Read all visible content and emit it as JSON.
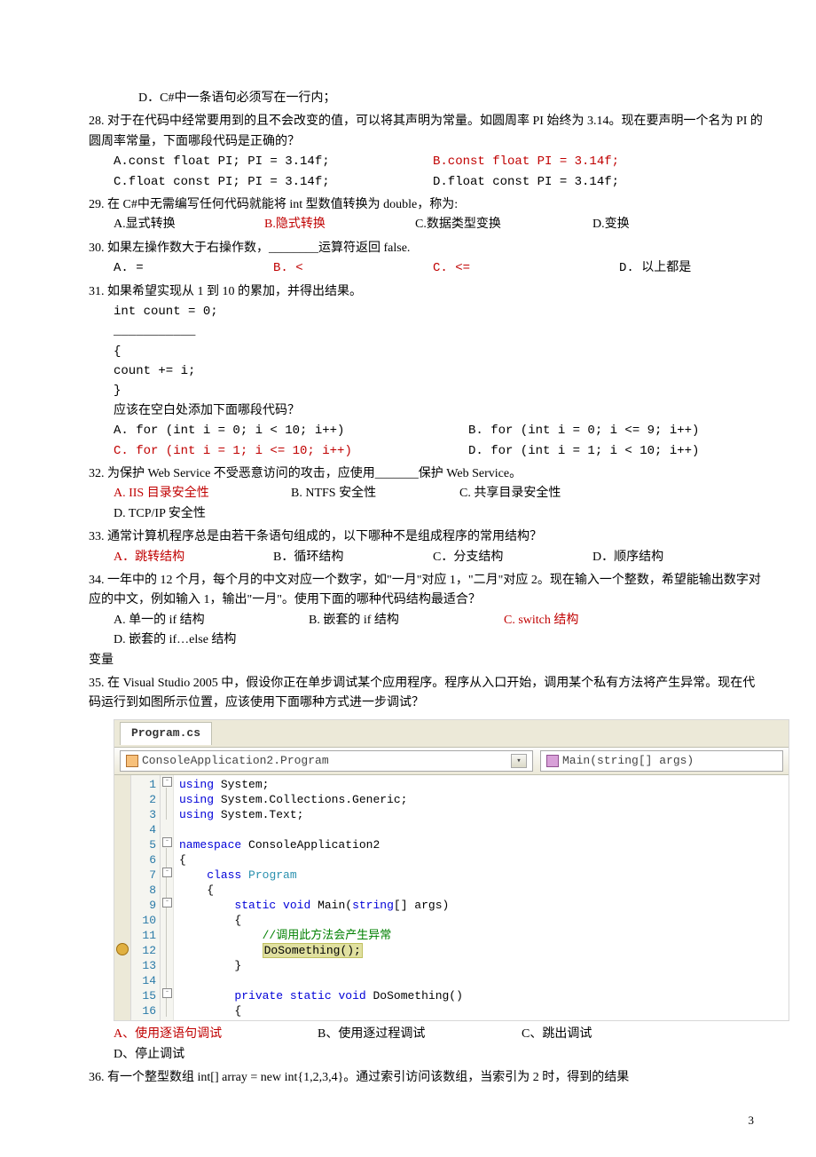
{
  "q27d": "D．C#中一条语句必须写在一行内；",
  "q28": {
    "num": "28.",
    "text": "对于在代码中经常要用到的且不会改变的值，可以将其声明为常量。如圆周率 PI 始终为 3.14。现在要声明一个名为 PI 的圆周率常量，下面哪段代码是正确的？",
    "a": "A.const float PI; PI = 3.14f;",
    "b": "B.const float PI = 3.14f;",
    "c": "C.float const PI; PI = 3.14f;",
    "d": "D.float const PI = 3.14f;"
  },
  "q29": {
    "num": "29.",
    "text": "在 C#中无需编写任何代码就能将 int 型数值转换为 double，称为:",
    "a": "A.显式转换",
    "b": "B.隐式转换",
    "c": "C.数据类型变换",
    "d": "D.变换"
  },
  "q30": {
    "num": "30.",
    "text": "如果左操作数大于右操作数，________运算符返回 false.",
    "a": "A. =",
    "b": "B. <",
    "c": "C. <=",
    "d": "D. 以上都是"
  },
  "q31": {
    "num": "31.",
    "text": "如果希望实现从 1 到 10 的累加，并得出结果。",
    "l1": "int count = 0;",
    "l2": "___________",
    "l3": "{",
    "l4": " count += i;",
    "l5": "}",
    "prompt": "应该在空白处添加下面哪段代码？",
    "a": "A. for (int i = 0; i < 10; i++)",
    "b": "B. for (int i = 0; i <= 9; i++)",
    "c": "C. for (int i = 1; i <= 10; i++)",
    "d": "D. for (int i = 1; i < 10; i++)"
  },
  "q32": {
    "num": "32.",
    "text": "为保护 Web Service 不受恶意访问的攻击，应使用_______保护 Web Service。",
    "a": "A. IIS 目录安全性",
    "b": "B. NTFS 安全性",
    "c": "C. 共享目录安全性",
    "d": "D. TCP/IP 安全性"
  },
  "q33": {
    "num": "33.",
    "text": "通常计算机程序总是由若干条语句组成的，以下哪种不是组成程序的常用结构？",
    "a": "A．跳转结构",
    "b": "B．循环结构",
    "c": "C．分支结构",
    "d": "D．顺序结构"
  },
  "q34": {
    "num": "34.",
    "text": "一年中的 12 个月，每个月的中文对应一个数字，如\"一月\"对应 1，\"二月\"对应 2。现在输入一个整数，希望能输出数字对应的中文，例如输入 1，输出\"一月\"。使用下面的哪种代码结构最适合？",
    "a": "A. 单一的 if 结构",
    "b": "B. 嵌套的 if 结构",
    "c": "C. switch 结构",
    "d": "D. 嵌套的 if…else 结构",
    "var": "变量"
  },
  "q35": {
    "num": "35.",
    "text": "在 Visual Studio 2005 中，假设你正在单步调试某个应用程序。程序从入口开始，调用某个私有方法将产生异常。现在代码运行到如图所示位置，应该使用下面哪种方式进一步调试？",
    "a": "A、使用逐语句调试",
    "b": "B、使用逐过程调试",
    "c": "C、跳出调试",
    "d": "D、停止调试"
  },
  "q36": {
    "num": "36.",
    "text": "有一个整型数组 int[] array = new int{1,2,3,4}。通过索引访问该数组，当索引为 2 时，得到的结果"
  },
  "ide": {
    "tab": "Program.cs",
    "dd1": "ConsoleApplication2.Program",
    "dd2": "Main(string[] args)",
    "comment": "//调用此方法会产生异常",
    "call": "DoSomething();"
  },
  "page_num": "3"
}
